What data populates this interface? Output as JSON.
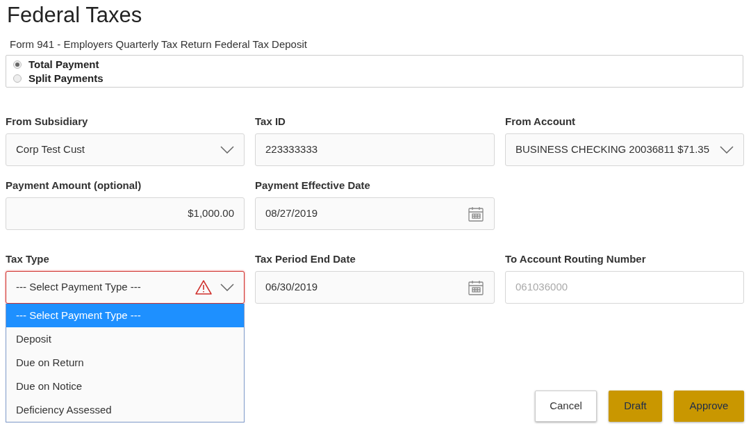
{
  "title": "Federal Taxes",
  "subtitle": "Form 941 - Employers Quarterly Tax Return Federal Tax Deposit",
  "payment_options": [
    {
      "label": "Total Payment",
      "selected": true
    },
    {
      "label": "Split Payments",
      "selected": false
    }
  ],
  "rows": [
    [
      {
        "label": "From Subsidiary",
        "kind": "select",
        "value": "Corp Test Cust",
        "invalid": false,
        "disabled": false
      },
      {
        "label": "Tax ID",
        "kind": "text",
        "value": "223333333",
        "invalid": false,
        "disabled": false
      },
      {
        "label": "From Account",
        "kind": "select",
        "value": "BUSINESS CHECKING 20036811 $71.35",
        "invalid": false,
        "disabled": false
      }
    ],
    [
      {
        "label": "Payment Amount (optional)",
        "kind": "amount",
        "value": "$1,000.00",
        "invalid": false,
        "disabled": false
      },
      {
        "label": "Payment Effective Date",
        "kind": "date",
        "value": "08/27/2019",
        "invalid": false,
        "disabled": false
      }
    ],
    [
      {
        "label": "Tax Type",
        "kind": "select",
        "value": "--- Select Payment Type ---",
        "invalid": true,
        "disabled": false,
        "expanded": true,
        "options": [
          {
            "label": "--- Select Payment Type ---",
            "selected": true
          },
          {
            "label": "Deposit",
            "selected": false
          },
          {
            "label": "Due on Return",
            "selected": false
          },
          {
            "label": "Due on Notice",
            "selected": false
          },
          {
            "label": "Deficiency Assessed",
            "selected": false
          }
        ]
      },
      {
        "label": "Tax Period End Date",
        "kind": "date",
        "value": "06/30/2019",
        "invalid": false,
        "disabled": false
      },
      {
        "label": "To Account Routing Number",
        "kind": "text",
        "value": "061036000",
        "invalid": false,
        "disabled": true
      }
    ]
  ],
  "buttons": [
    {
      "label": "Cancel",
      "kind": "secondary"
    },
    {
      "label": "Draft",
      "kind": "primary"
    },
    {
      "label": "Approve",
      "kind": "primary"
    }
  ]
}
